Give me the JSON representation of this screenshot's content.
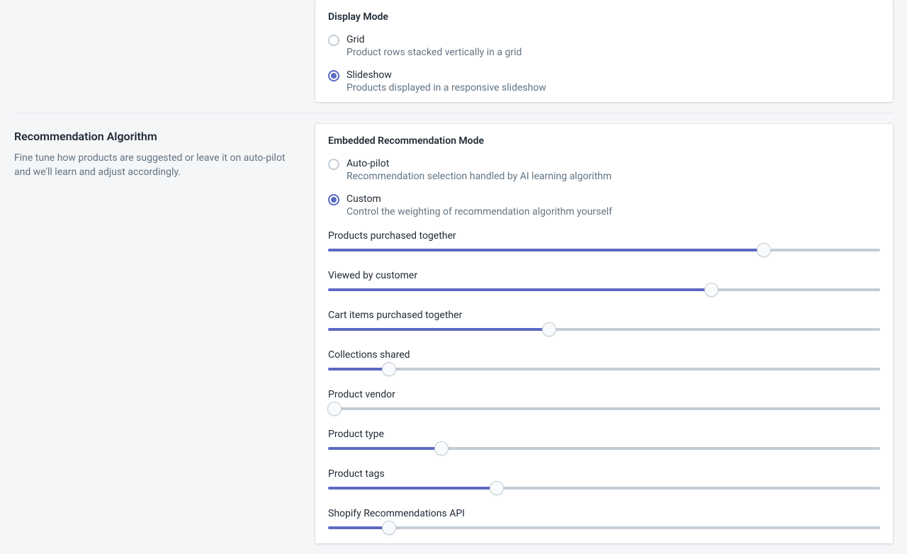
{
  "display_mode": {
    "heading": "Display Mode",
    "options": [
      {
        "label": "Grid",
        "desc": "Product rows stacked vertically in a grid",
        "selected": false
      },
      {
        "label": "Slideshow",
        "desc": "Products displayed in a responsive slideshow",
        "selected": true
      }
    ]
  },
  "algorithm": {
    "title": "Recommendation Algorithm",
    "desc": "Fine tune how products are suggested or leave it on auto-pilot and we'll learn and adjust accordingly.",
    "heading": "Embedded Recommendation Mode",
    "options": [
      {
        "label": "Auto-pilot",
        "desc": "Recommendation selection handled by AI learning algorithm",
        "selected": false
      },
      {
        "label": "Custom",
        "desc": "Control the weighting of recommendation algorithm yourself",
        "selected": true
      }
    ],
    "sliders": [
      {
        "label": "Products purchased together",
        "value": 79
      },
      {
        "label": "Viewed by customer",
        "value": 69.5
      },
      {
        "label": "Cart items purchased together",
        "value": 40
      },
      {
        "label": "Collections shared",
        "value": 11
      },
      {
        "label": "Product vendor",
        "value": 1.2
      },
      {
        "label": "Product type",
        "value": 20.5
      },
      {
        "label": "Product tags",
        "value": 30.5
      },
      {
        "label": "Shopify Recommendations API",
        "value": 11
      }
    ]
  }
}
